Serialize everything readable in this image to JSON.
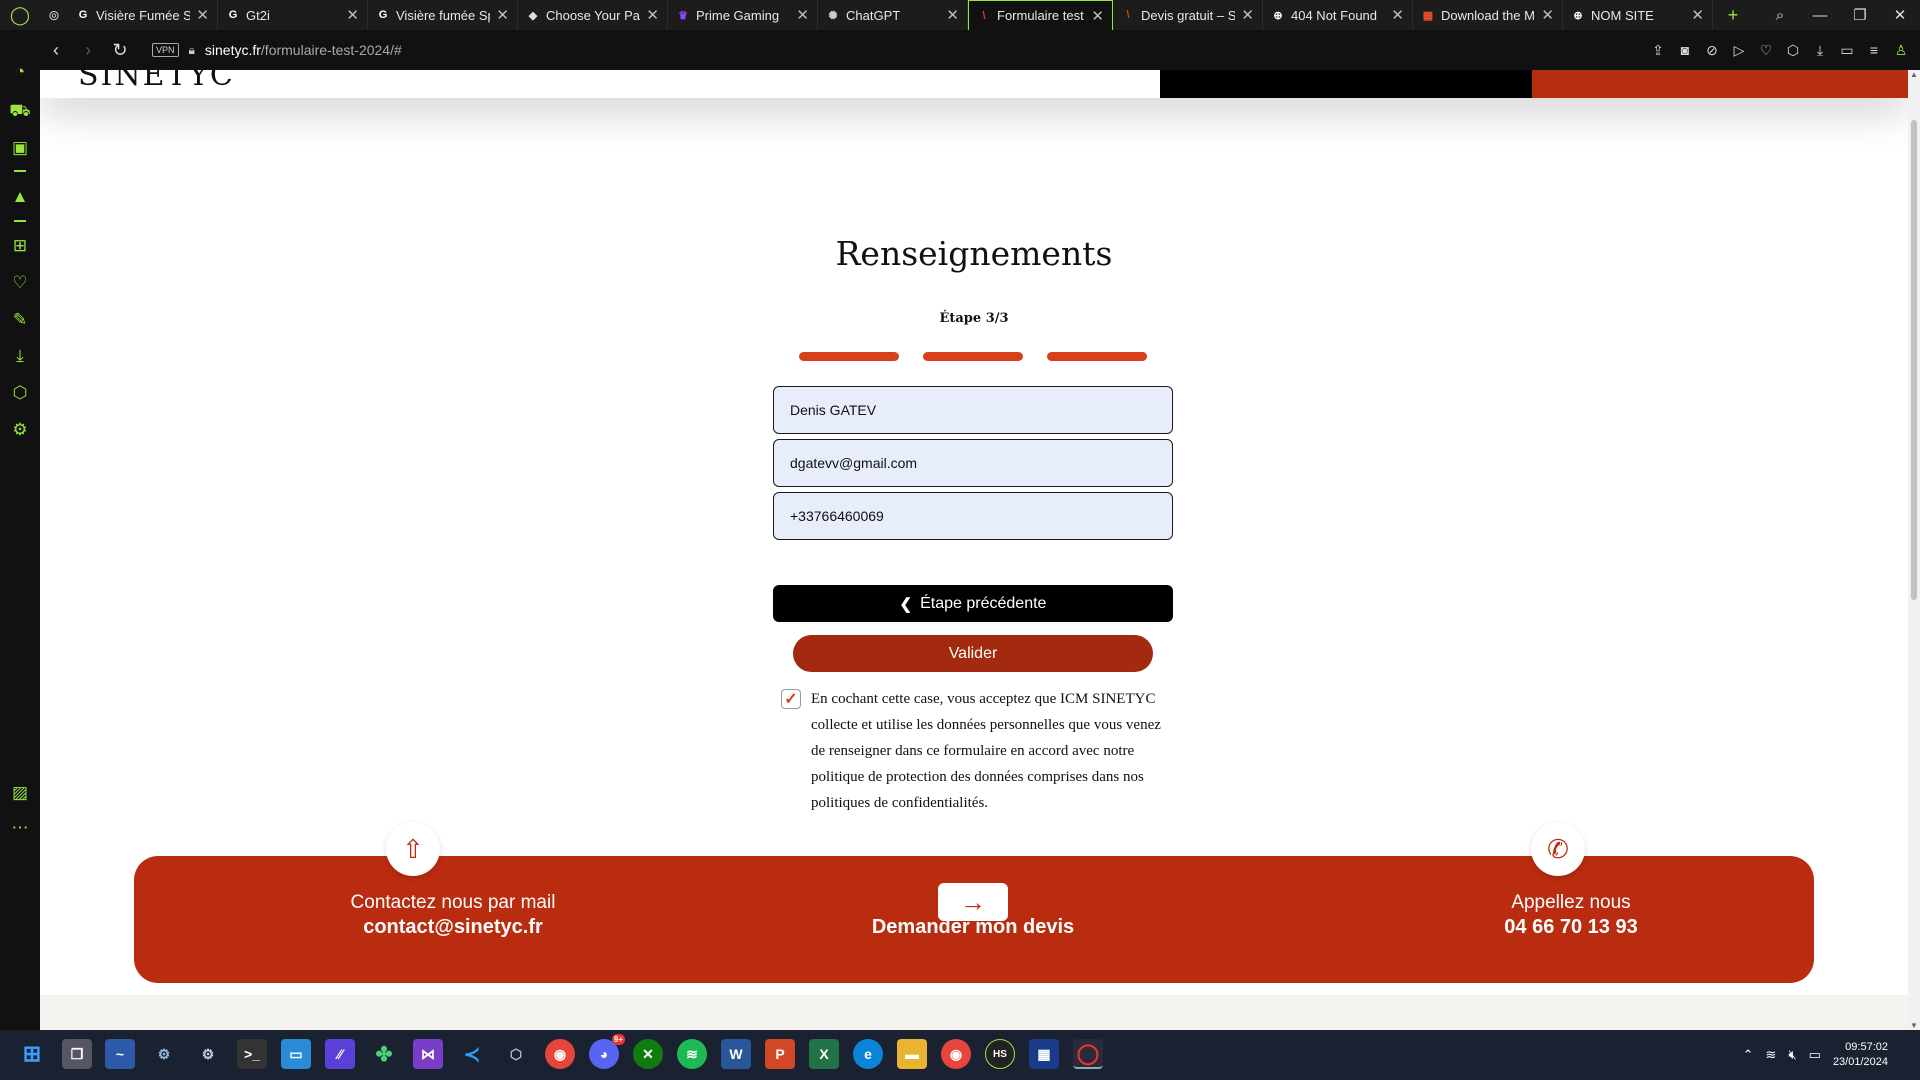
{
  "browser": {
    "tabs": [
      {
        "title": "Visière Fumée Sp",
        "fav": "G",
        "favcolor": "#ffffff"
      },
      {
        "title": "Gt2i",
        "fav": "G",
        "favcolor": "#ffffff"
      },
      {
        "title": "Visière fumée Sp",
        "fav": "G",
        "favcolor": "#ffffff"
      },
      {
        "title": "Choose Your Part",
        "fav": "◆",
        "favcolor": "#dddddd"
      },
      {
        "title": "Prime Gaming",
        "fav": "♛",
        "favcolor": "#9146ff"
      },
      {
        "title": "ChatGPT",
        "fav": "✺",
        "favcolor": "#cfcfcf"
      },
      {
        "title": "Formulaire test -",
        "fav": "\\",
        "favcolor": "#d6401a"
      },
      {
        "title": "Devis gratuit – Sin",
        "fav": "\\",
        "favcolor": "#d6401a"
      },
      {
        "title": "404 Not Found",
        "fav": "⊕",
        "favcolor": "#ffffff"
      },
      {
        "title": "Download the Mi",
        "fav": "▦",
        "favcolor": "#f25022"
      },
      {
        "title": "NOM SITE",
        "fav": "⊕",
        "favcolor": "#ffffff"
      }
    ],
    "url_domain": "sinetyc.fr",
    "url_path": "/formulaire-test-2024/#",
    "vpn_label": "VPN"
  },
  "page": {
    "logo_text": "SINETYC",
    "title": "Renseignements",
    "step_label": "Étape 3/3",
    "progress_steps_completed": 3,
    "fields": {
      "name": "Denis GATEV",
      "email": "dgatevv@gmail.com",
      "phone": "+33766460069"
    },
    "prev_button": "Étape précédente",
    "submit_button": "Valider",
    "consent_checked": true,
    "consent_text": "En cochant cette case, vous acceptez que ICM SINETYC collecte et utilise les données personnelles que vous venez de renseigner dans ce formulaire en accord avec notre politique de protection des données comprises dans nos politiques de confidentialités."
  },
  "contact": {
    "mail_label": "Contactez nous par mail",
    "mail_value": "contact@sinetyc.fr",
    "quote_label": "Demander mon devis",
    "phone_label": "Appellez nous",
    "phone_value": "04 66 70 13 93"
  },
  "taskbar": {
    "time": "09:57:02",
    "date": "23/01/2024",
    "discord_badge": "9+"
  },
  "colors": {
    "accent": "#b92c10",
    "progress": "#d6401a",
    "opera_green": "#9ae43f"
  }
}
